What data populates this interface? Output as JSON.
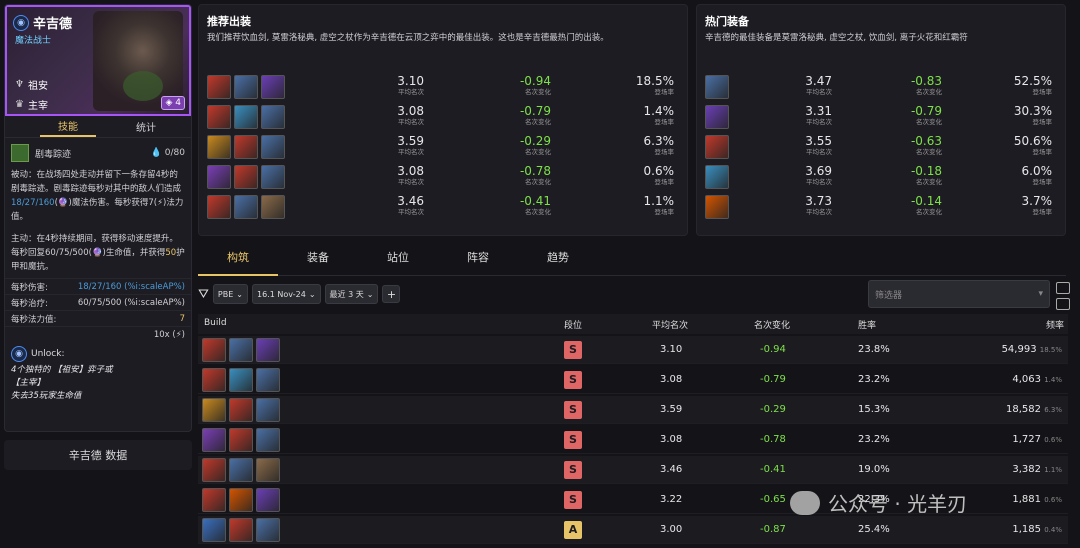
{
  "champion": {
    "name": "辛吉德",
    "role": "魔法战士",
    "traits": [
      {
        "icon": "guardian-icon",
        "label": "祖安"
      },
      {
        "icon": "dominator-icon",
        "label": "主宰"
      }
    ],
    "cost": "4"
  },
  "left_tabs": [
    "技能",
    "统计"
  ],
  "ability": {
    "name": "剧毒踪迹",
    "mana": "0",
    "mana_max": "/80",
    "passive": [
      "被动：在战场四处走动并留下一条存留4秒的剧毒踪迹。剧毒踪迹每秒对其中的敌人们造成",
      "18/27/160",
      "(",
      "🔮",
      ")魔法伤害。每秒获得7(",
      "⚡",
      ")法力值。"
    ],
    "active": [
      "主动：在4秒持续期间，获得移动速度提升。每秒回复",
      "60/75/500",
      "(",
      "🔮",
      ")生命值，并获得",
      "50",
      "护甲和魔抗。"
    ]
  },
  "stats": [
    {
      "label": "每秒伤害:",
      "value": "18/27/160 (%i:scaleAP%)"
    },
    {
      "label": "每秒治疗:",
      "value": "60/75/500 (%i:scaleAP%)"
    },
    {
      "label": "每秒法力值:",
      "value": "7"
    },
    {
      "label": "",
      "value": "10x (⚡)"
    }
  ],
  "unlock": {
    "title": "Unlock:",
    "lines": [
      "4个独特的 【祖安】弈子或",
      "【主宰】",
      "失去35玩家生命值"
    ]
  },
  "data_button": "辛吉德 数据",
  "recommended": {
    "title": "推荐出装",
    "subtitle": "我们推荐饮血剑, 莫雷洛秘典, 虚空之杖作为辛吉德在云顶之弈中的最佳出装。这也是辛吉德最热门的出装。",
    "rows": [
      {
        "items": [
          "#c0392b",
          "#4a6fa5",
          "#6a3fb5"
        ],
        "avg": "3.10",
        "change": "-0.94",
        "rate": "18.5%"
      },
      {
        "items": [
          "#c0392b",
          "#3a8fbf",
          "#4a6fa5"
        ],
        "avg": "3.08",
        "change": "-0.79",
        "rate": "1.4%"
      },
      {
        "items": [
          "#c88a1f",
          "#c0392b",
          "#4a6fa5"
        ],
        "avg": "3.59",
        "change": "-0.29",
        "rate": "6.3%"
      },
      {
        "items": [
          "#7a3fb5",
          "#c0392b",
          "#4a6fa5"
        ],
        "avg": "3.08",
        "change": "-0.78",
        "rate": "0.6%"
      },
      {
        "items": [
          "#c0392b",
          "#4a6fa5",
          "#8a6a4a"
        ],
        "avg": "3.46",
        "change": "-0.41",
        "rate": "1.1%"
      }
    ],
    "labels": {
      "avg": "平均名次",
      "change": "名次变化",
      "rate": "登场率"
    }
  },
  "popular": {
    "title": "热门装备",
    "subtitle": "辛吉德的最佳装备是莫雷洛秘典, 虚空之杖, 饮血剑, 离子火花和红霸符",
    "rows": [
      {
        "item": "#4a6fa5",
        "avg": "3.47",
        "change": "-0.83",
        "rate": "52.5%"
      },
      {
        "item": "#6a3fb5",
        "avg": "3.31",
        "change": "-0.79",
        "rate": "30.3%"
      },
      {
        "item": "#c0392b",
        "avg": "3.55",
        "change": "-0.63",
        "rate": "50.6%"
      },
      {
        "item": "#3a8fbf",
        "avg": "3.69",
        "change": "-0.18",
        "rate": "6.0%"
      },
      {
        "item": "#d35400",
        "avg": "3.73",
        "change": "-0.14",
        "rate": "3.7%"
      }
    ]
  },
  "main_tabs": [
    "构筑",
    "装备",
    "站位",
    "阵容",
    "趋势"
  ],
  "filters": {
    "server": "PBE",
    "patch": "16.1 Nov-24",
    "range": "最近 3 天",
    "search_placeholder": "筛选器"
  },
  "table": {
    "headers": [
      "Build",
      "段位",
      "平均名次",
      "名次变化",
      "胜率",
      "频率"
    ],
    "rows": [
      {
        "items": [
          "#c0392b",
          "#4a6fa5",
          "#6a3fb5"
        ],
        "tier": "S",
        "avg": "3.10",
        "change": "-0.94",
        "win": "23.8%",
        "freq": "54,993",
        "pct": "18.5%"
      },
      {
        "items": [
          "#c0392b",
          "#3a8fbf",
          "#4a6fa5"
        ],
        "tier": "S",
        "avg": "3.08",
        "change": "-0.79",
        "win": "23.2%",
        "freq": "4,063",
        "pct": "1.4%"
      },
      {
        "items": [
          "#c88a1f",
          "#c0392b",
          "#4a6fa5"
        ],
        "tier": "S",
        "avg": "3.59",
        "change": "-0.29",
        "win": "15.3%",
        "freq": "18,582",
        "pct": "6.3%"
      },
      {
        "items": [
          "#7a3fb5",
          "#c0392b",
          "#4a6fa5"
        ],
        "tier": "S",
        "avg": "3.08",
        "change": "-0.78",
        "win": "23.2%",
        "freq": "1,727",
        "pct": "0.6%"
      },
      {
        "items": [
          "#c0392b",
          "#4a6fa5",
          "#8a6a4a"
        ],
        "tier": "S",
        "avg": "3.46",
        "change": "-0.41",
        "win": "19.0%",
        "freq": "3,382",
        "pct": "1.1%"
      },
      {
        "items": [
          "#c0392b",
          "#d35400",
          "#6a3fb5"
        ],
        "tier": "S",
        "avg": "3.22",
        "change": "-0.65",
        "win": "22.3%",
        "freq": "1,881",
        "pct": "0.6%"
      },
      {
        "items": [
          "#3a6fbf",
          "#c0392b",
          "#4a6fa5"
        ],
        "tier": "A",
        "avg": "3.00",
        "change": "-0.87",
        "win": "25.4%",
        "freq": "1,185",
        "pct": "0.4%"
      }
    ]
  },
  "watermark": "公众号 · 光羊刃",
  "colors": {
    "accent": "#e8c469",
    "positive": "#7ee04a",
    "tier_s": "#e06666",
    "tier_a": "#e8c469",
    "border_hero": "#a855f7"
  }
}
